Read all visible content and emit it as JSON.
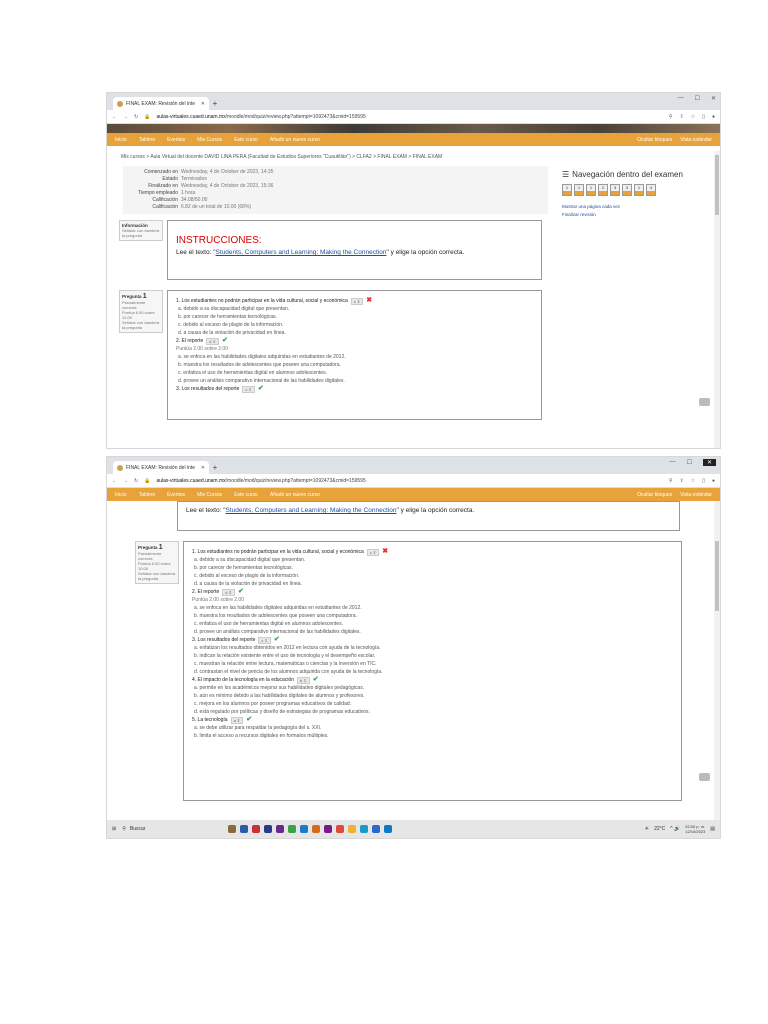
{
  "browser": {
    "tab_title": "FINAL EXAM: Revisión del inte",
    "url_host": "aulas-virtuales.cuaed.unam.mx",
    "url_path": "/moodle/mod/quiz/review.php?attempt=1092473&cmid=159595"
  },
  "navbar": {
    "items": [
      "Inicio",
      "Tablero",
      "Eventos",
      "Mis Cursos",
      "Este curso",
      "Añadir un nuevo curso"
    ],
    "right_items": [
      "Ocultar bloques",
      "Vista estándar"
    ]
  },
  "breadcrumb": "Mis cursos > Aula Virtual del docente DAVID LINA PERA (Facultad de Estudios Superiores \"Cuautitlán\") > CLFA2 > FINAL EXAM > FINAL EXAM",
  "summary": [
    {
      "label": "Comenzado en",
      "value": "Wednesday, 4 de October de 2023, 14:35"
    },
    {
      "label": "Estado",
      "value": "Terminados"
    },
    {
      "label": "Finalizado en",
      "value": "Wednesday, 4 de October de 2023, 15:36"
    },
    {
      "label": "Tiempo empleado",
      "value": "1 hora"
    },
    {
      "label": "Calificación",
      "value": "34.08/50.00"
    },
    {
      "label": "Calificación",
      "value": "6.82 de un total de 10.00 (68%)"
    }
  ],
  "info_side": {
    "title": "Información",
    "flag": "Señalar con bandera la pregunta"
  },
  "instructions": {
    "title": "INSTRUCCIONES:",
    "pre": "Lee el texto: \"",
    "link": "Students, Computers and Learning: Making the Connection",
    "post": "\" y elige la opción correcta."
  },
  "question_side": {
    "title": "Pregunta",
    "number": "1",
    "state": "Parcialmente correcta",
    "points": "Puntúa 6.50 sobre 10.00",
    "flag": "Señalar con bandera la pregunta"
  },
  "questions": [
    {
      "head": "1. Los estudiantes no podrán participar en la vida cultural, social y económica",
      "mark": "x",
      "points": "",
      "options": [
        "a. debido a su discapacidad digital que presentan.",
        "b. por carecer de herramientas tecnológicas.",
        "c. debido al exceso de plagio de la información.",
        "d. a causa de la violación de privacidad en línea."
      ]
    },
    {
      "head": "2. El reporte",
      "mark": "check",
      "points": "Puntúa 2.00 sobre 2.00",
      "options": [
        "a. se enfoca en las habilidades digitales adquiridas en estudiantes de 2012.",
        "b. muestra los resultados de adolescentes que poseen una computadora.",
        "c. enfatiza el uso de herramientas digital en alumnos adolescentes.",
        "d. provee un análisis comparativo internacional de las habilidades digitales."
      ]
    },
    {
      "head": "3. Los resultados del reporte",
      "mark": "check",
      "points": "",
      "options": [
        "a. enfatizan los resultados obtenidos en 2012 en lectura con ayuda de la tecnología.",
        "b. indican la relación existente entre el uso de tecnología y el desempeño escolar.",
        "c. muestran la relación entre lectura, matemáticas o ciencias y la inversión en TIC.",
        "d. contrastan el nivel de pericia de los alumnos adquirida con ayuda de la tecnología."
      ]
    },
    {
      "head": "4. El impacto de la tecnología en la educación",
      "mark": "check",
      "points": "",
      "options": [
        "a. permite en los académicos mejorar sus habilidades digitales pedagógicas.",
        "b. aún es mínimo debido a las habilidades digitales de alumnos y profesores.",
        "c. mejora en los alumnos por poseer programas educativos de calidad.",
        "d. está regulado por políticas y diseño de estrategias de programas educativos."
      ]
    },
    {
      "head": "5. La tecnología",
      "mark": "check",
      "points": "",
      "options": [
        "a. se debe utilizar para respaldar la pedagogía del s. XXI.",
        "b. limita el acceso a recursos digitales en formatos múltiples."
      ]
    }
  ],
  "quiz_nav": {
    "title": "Navegación dentro del examen",
    "buttons": [
      "1",
      "1",
      "1",
      "2",
      "3",
      "3",
      "1",
      "4"
    ],
    "link1": "Mostrar una página cada vez",
    "link2": "Finalizar revisión"
  },
  "taskbar": {
    "search": "Buscar",
    "temp": "22°C",
    "time": "02:00 p. m.",
    "date": "12/10/2023"
  },
  "colors": {
    "accent": "#e8a23a",
    "link": "#1a4fa0",
    "error": "#dd3333",
    "ok": "#3ea34a"
  }
}
